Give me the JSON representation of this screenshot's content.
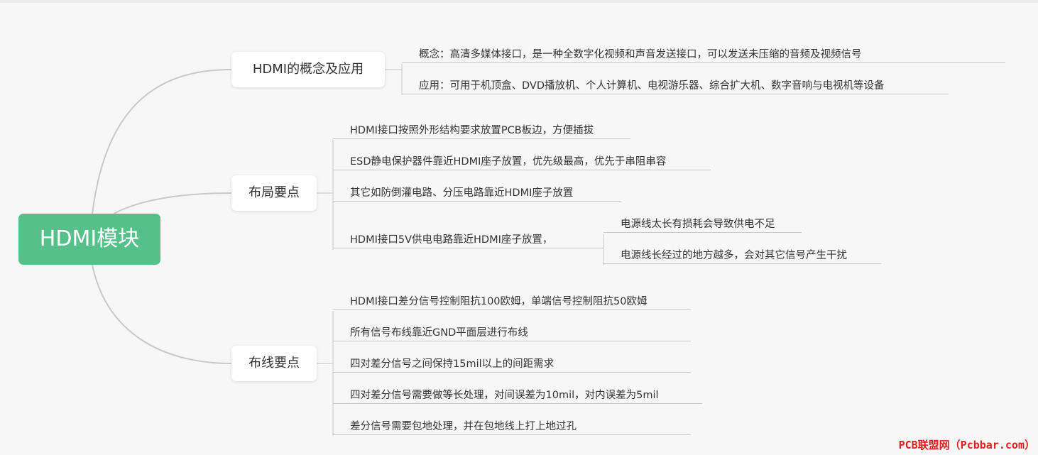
{
  "root": {
    "label": "HDMI模块"
  },
  "branches": [
    {
      "label": "HDMI的概念及应用",
      "items": [
        {
          "label": "概念：高清多媒体接口，是一种全数字化视频和声音发送接口，可以发送未压缩的音频及视频信号"
        },
        {
          "label": "应用：可用于机顶盒、DVD播放机、个人计算机、电视游乐器、综合扩大机、数字音响与电视机等设备"
        }
      ]
    },
    {
      "label": "布局要点",
      "items": [
        {
          "label": "HDMI接口按照外形结构要求放置PCB板边，方便插拔"
        },
        {
          "label": "ESD静电保护器件靠近HDMI座子放置，优先级最高，优先于串阻串容"
        },
        {
          "label": "其它如防倒灌电路、分压电路靠近HDMI座子放置"
        },
        {
          "label": "HDMI接口5V供电电路靠近HDMI座子放置，",
          "children": [
            {
              "label": "电源线太长有损耗会导致供电不足"
            },
            {
              "label": "电源线长经过的地方越多，会对其它信号产生干扰"
            }
          ]
        }
      ]
    },
    {
      "label": "布线要点",
      "items": [
        {
          "label": "HDMI接口差分信号控制阻抗100欧姆，单端信号控制阻抗50欧姆"
        },
        {
          "label": "所有信号布线靠近GND平面层进行布线"
        },
        {
          "label": "四对差分信号之间保持15mil以上的间距需求"
        },
        {
          "label": "四对差分信号需要做等长处理，对间误差为10mil，对内误差为5mil"
        },
        {
          "label": "差分信号需要包地处理，并在包地线上打上地过孔"
        }
      ]
    }
  ],
  "watermark": "PCB联盟网（Pcbbar.com）",
  "colors": {
    "root_fill": "#55c08a",
    "branch_fill": "#ffffff",
    "connector": "#c9c9c9",
    "watermark": "#e02020"
  }
}
